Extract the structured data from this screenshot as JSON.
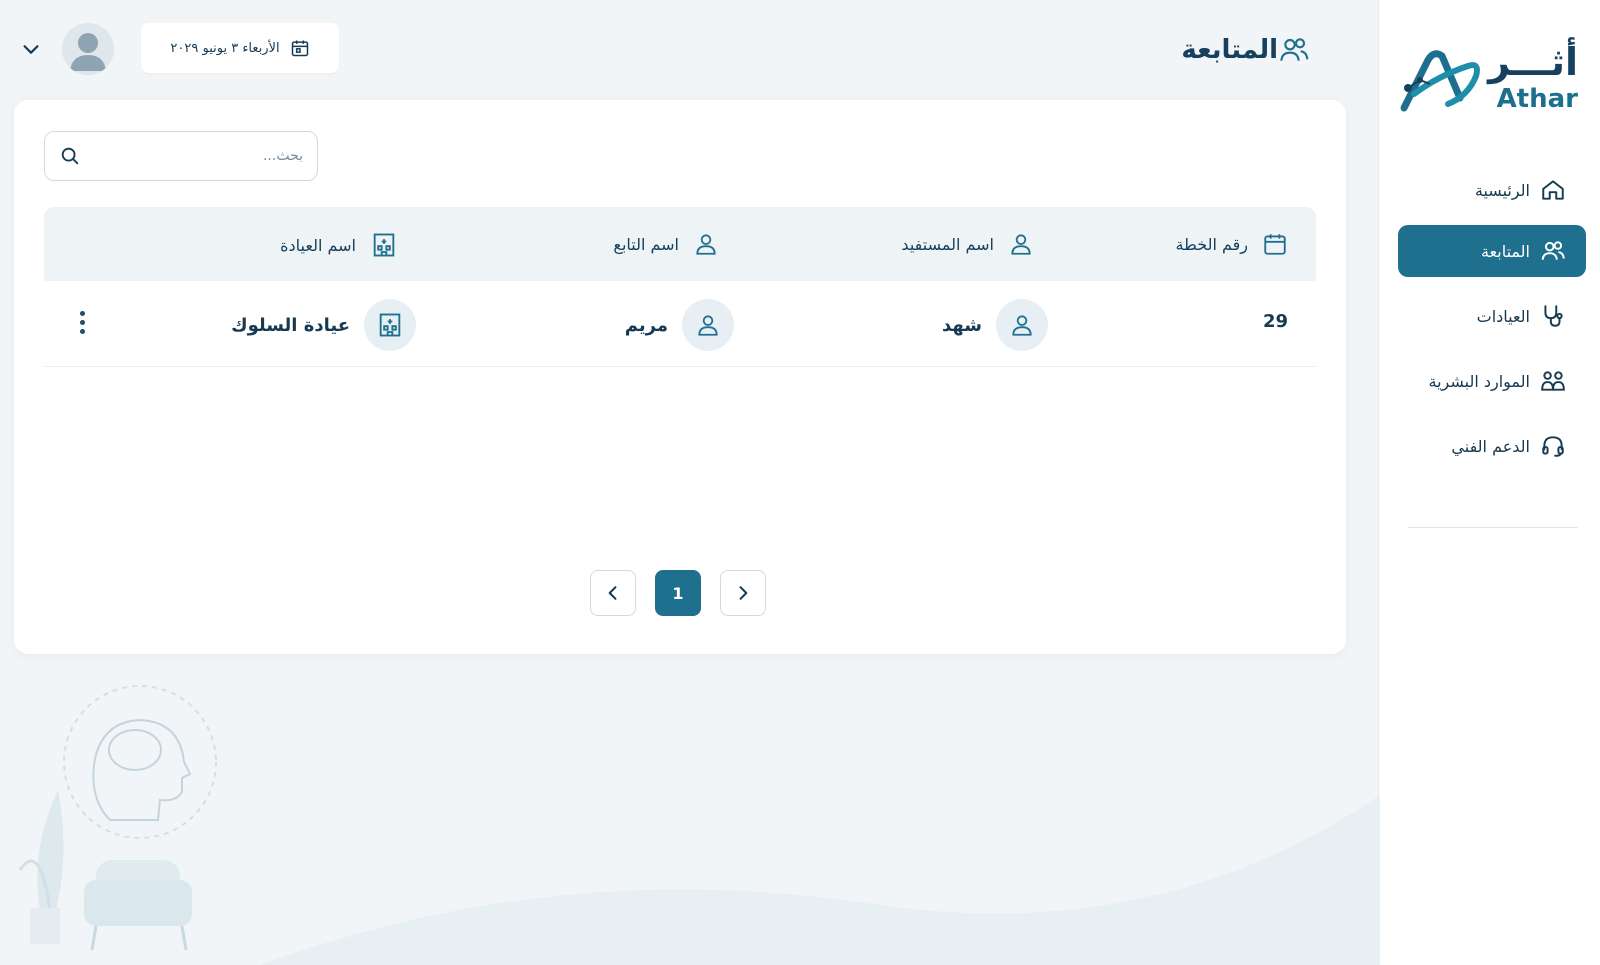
{
  "sidebar": {
    "logo": {
      "arabic": "أثـــر",
      "english": "Athar"
    },
    "items": [
      {
        "label": "الرئيسية",
        "icon": "home-icon",
        "active": false
      },
      {
        "label": "المتابعة",
        "icon": "users-icon",
        "active": true
      },
      {
        "label": "العيادات",
        "icon": "stethoscope-icon",
        "active": false
      },
      {
        "label": "الموارد البشرية",
        "icon": "people-icon",
        "active": false
      },
      {
        "label": "الدعم الفني",
        "icon": "headset-icon",
        "active": false
      }
    ]
  },
  "header": {
    "title": "المتابعة",
    "title_icon": "users-icon",
    "date": "الأربعاء ٣ يونيو ٢٠٢٩",
    "date_icon": "calendar-icon"
  },
  "search": {
    "placeholder": "بحث..."
  },
  "table": {
    "columns": [
      {
        "label": "رقم الخطة",
        "icon": "calendar-icon"
      },
      {
        "label": "اسم المستفيد",
        "icon": "user-icon"
      },
      {
        "label": "اسم التابع",
        "icon": "user-icon"
      },
      {
        "label": "اسم العيادة",
        "icon": "building-icon"
      }
    ],
    "rows": [
      {
        "plan_number": "29",
        "beneficiary": "شهد",
        "dependent": "مريم",
        "clinic": "عيادة السلوك"
      }
    ]
  },
  "pagination": {
    "current": "1"
  },
  "colors": {
    "primary": "#1f6f8f",
    "dark": "#17405e",
    "background": "#f2f5f7"
  }
}
